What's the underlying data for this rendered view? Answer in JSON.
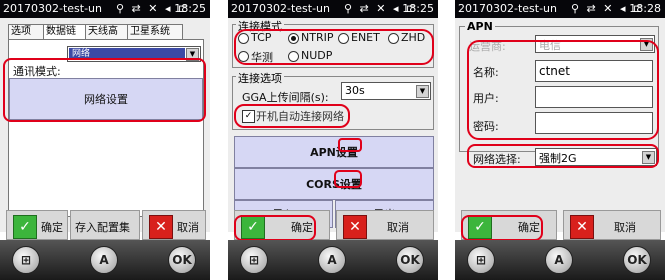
{
  "status": {
    "title": "20170302-test-un",
    "icons": "⚲ ⇄ ✕ ◂ ⊏",
    "time_1": "18:25",
    "time_2": "18:25",
    "time_3": "18:28"
  },
  "panel1": {
    "tabs": [
      "选项",
      "数据链",
      "天线高",
      "卫星系统"
    ],
    "comm_mode_label": "通讯模式:",
    "comm_mode_value": "网络",
    "network_settings_btn": "网络设置",
    "confirm": "确定",
    "save_config": "存入配置集",
    "cancel": "取消"
  },
  "panel2": {
    "connect_mode_legend": "连接模式",
    "radios": [
      "TCP",
      "NTRIP",
      "ENET",
      "ZHD",
      "华测",
      "NUDP"
    ],
    "selected_radio": "NTRIP",
    "connect_options_legend": "连接选项",
    "gga_label": "GGA上传间隔(s):",
    "gga_value": "30s",
    "auto_connect_label": "开机自动连接网络",
    "apn_btn": "APN设置",
    "cors_btn": "CORS设置",
    "import_btn": "导入",
    "export_btn": "导出",
    "confirm": "确定",
    "cancel": "取消"
  },
  "panel3": {
    "apn_legend": "APN",
    "operator_label": "运营商:",
    "operator_value": "电信",
    "name_label": "名称:",
    "name_value": "ctnet",
    "user_label": "用户:",
    "user_value": "",
    "password_label": "密码:",
    "password_value": "",
    "network_select_label": "网络选择:",
    "network_select_value": "强制2G",
    "confirm": "确定",
    "cancel": "取消"
  },
  "nav": {
    "windows_icon": "windows-flag-icon",
    "a_label": "A",
    "ok_label": "OK"
  },
  "colors": {
    "highlight": "#e0001a",
    "button_lavender": "#d6d7f4",
    "status_bar": "#06060a"
  }
}
